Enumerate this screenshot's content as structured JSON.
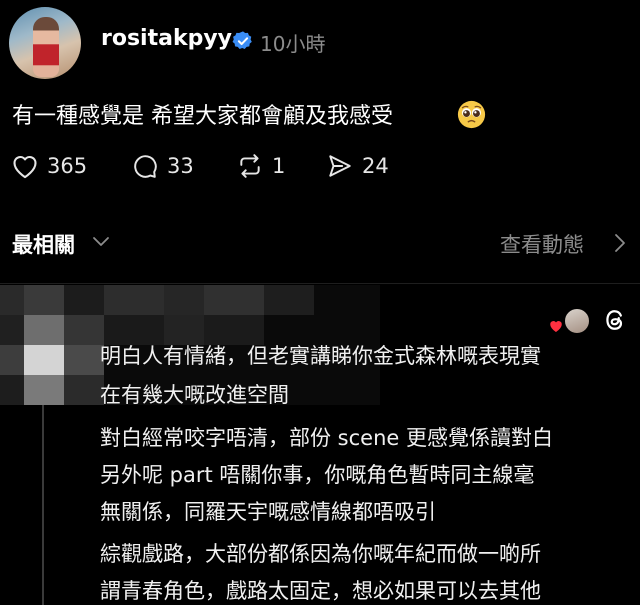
{
  "post": {
    "username": "rositakpyy",
    "time": "10小時",
    "text": "有一種感覺是 希望大家都會顧及我感受",
    "likes": "365",
    "comments": "33",
    "reposts": "1",
    "shares": "24"
  },
  "section": {
    "title": "最相關",
    "activity_link": "查看動態"
  },
  "comment": {
    "lines": [
      "明白人有情緒，但老實講睇你金式森林嘅表現實",
      "在有幾大嘅改進空間",
      "對白經常咬字唔清，部份 scene 更感覺係讀對白",
      "另外呢 part 唔關你事，你嘅角色暫時同主線毫",
      "無關係，同羅天宇嘅感情線都唔吸引",
      "綜觀戲路，大部份都係因為你嘅年紀而做一啲所",
      "謂青春角色，戲路太固定，想必如果可以去其他"
    ]
  },
  "colors": {
    "background": "#000000",
    "verified": "#3a8df5",
    "muted": "#8c8c8c",
    "heart_red": "#ff3040"
  },
  "icons": [
    "verified-badge-icon",
    "pleading-face-emoji",
    "heart-icon",
    "comment-icon",
    "repost-icon",
    "share-icon",
    "chevron-down-icon",
    "chevron-right-icon",
    "threads-logo-icon"
  ]
}
